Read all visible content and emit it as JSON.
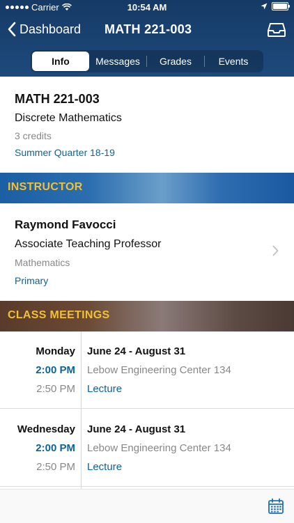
{
  "status_bar": {
    "carrier": "Carrier",
    "time": "10:54 AM"
  },
  "nav": {
    "back_label": "Dashboard",
    "title": "MATH 221-003"
  },
  "tabs": [
    {
      "label": "Info",
      "active": true
    },
    {
      "label": "Messages",
      "active": false
    },
    {
      "label": "Grades",
      "active": false
    },
    {
      "label": "Events",
      "active": false
    }
  ],
  "course": {
    "code": "MATH 221-003",
    "name": "Discrete Mathematics",
    "credits": "3 credits",
    "term": "Summer Quarter 18-19"
  },
  "sections": {
    "instructor": "INSTRUCTOR",
    "class_meetings": "CLASS MEETINGS"
  },
  "instructor": {
    "name": "Raymond Favocci",
    "title": "Associate Teaching Professor",
    "department": "Mathematics",
    "role": "Primary"
  },
  "meetings": [
    {
      "day": "Monday",
      "start": "2:00 PM",
      "end": "2:50 PM",
      "dates": "June 24 - August 31",
      "location": "Lebow Engineering Center 134",
      "type": "Lecture"
    },
    {
      "day": "Wednesday",
      "start": "2:00 PM",
      "end": "2:50 PM",
      "dates": "June 24 - August 31",
      "location": "Lebow Engineering Center 134",
      "type": "Lecture"
    }
  ],
  "icons": {
    "back": "chevron-left-icon",
    "inbox": "inbox-icon",
    "calendar": "calendar-icon",
    "disclosure": "chevron-right-icon"
  },
  "colors": {
    "nav_bg": "#1d4a7c",
    "link_blue": "#0d6494",
    "section_gold": "#f2c033"
  }
}
